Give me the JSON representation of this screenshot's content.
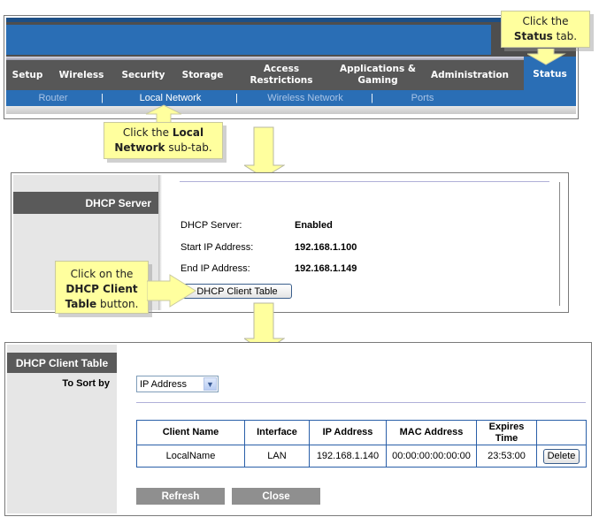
{
  "router": {
    "tabs": [
      {
        "label": "Setup"
      },
      {
        "label": "Wireless"
      },
      {
        "label": "Security"
      },
      {
        "label": "Storage"
      },
      {
        "label": "Access Restrictions"
      },
      {
        "label": "Applications & Gaming"
      },
      {
        "label": "Administration"
      },
      {
        "label": "Status"
      }
    ],
    "subtabs": [
      {
        "label": "Router"
      },
      {
        "label": "Local Network"
      },
      {
        "label": "Wireless Network"
      },
      {
        "label": "Ports"
      }
    ],
    "separator": "|"
  },
  "callouts": {
    "status": {
      "pre": "Click the",
      "bold": "Status",
      "post": "tab."
    },
    "local_network": {
      "pre": "Click the",
      "bold1": "Local",
      "bold2": "Network",
      "post": "sub-tab."
    },
    "dhcp_client_table": {
      "pre": "Click on the",
      "bold1": "DHCP Client",
      "bold2": "Table",
      "post": "button."
    }
  },
  "dhcp_server": {
    "section_title": "DHCP Server",
    "fields": [
      {
        "label": "DHCP Server:",
        "value": "Enabled"
      },
      {
        "label": "Start IP Address:",
        "value": "192.168.1.100"
      },
      {
        "label": "End IP Address:",
        "value": "192.168.1.149"
      }
    ],
    "button_label": "DHCP Client Table"
  },
  "client_table": {
    "section_title": "DHCP Client Table",
    "sort_label": "To Sort by",
    "sort_selected": "IP Address",
    "columns": [
      "Client Name",
      "Interface",
      "IP Address",
      "MAC Address",
      "Expires Time",
      ""
    ],
    "rows": [
      {
        "client_name": "LocalName",
        "interface": "LAN",
        "ip": "192.168.1.140",
        "mac": "00:00:00:00:00:00",
        "expires": "23:53:00",
        "action": "Delete"
      }
    ],
    "refresh_label": "Refresh",
    "close_label": "Close"
  },
  "colors": {
    "brand_blue": "#2a6eb5",
    "tab_gray": "#575757",
    "callout_yellow": "#ffff9e",
    "table_border": "#2a5fa8"
  }
}
